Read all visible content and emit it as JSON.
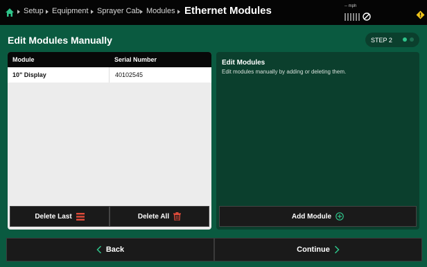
{
  "breadcrumb": {
    "items": [
      "Setup",
      "Equipment",
      "Sprayer Cab",
      "Modules"
    ],
    "current": "Ethernet Modules"
  },
  "status": {
    "speed": "-- mph"
  },
  "page": {
    "title": "Edit Modules Manually",
    "step_label": "STEP 2"
  },
  "table": {
    "headers": [
      "Module",
      "Serial Number"
    ],
    "rows": [
      {
        "module": "10\" Display",
        "serial": "40102545"
      }
    ]
  },
  "left_buttons": {
    "delete_last": "Delete Last",
    "delete_all": "Delete All"
  },
  "right_panel": {
    "title": "Edit Modules",
    "description": "Edit modules manually by adding or deleting them.",
    "add_button": "Add Module"
  },
  "nav": {
    "back": "Back",
    "continue": "Continue"
  },
  "colors": {
    "background": "#0a5a40",
    "panel_dark": "#0b3f2d",
    "accent": "#2ec48a",
    "danger": "#e04b3a"
  },
  "icons": {
    "home": "home-icon",
    "gps": "gps-icon",
    "warning": "warning-icon",
    "delete_last": "list-delete-icon",
    "delete_all": "trash-icon",
    "add": "plus-circle-icon",
    "back": "chevron-left-icon",
    "continue": "chevron-right-icon"
  }
}
